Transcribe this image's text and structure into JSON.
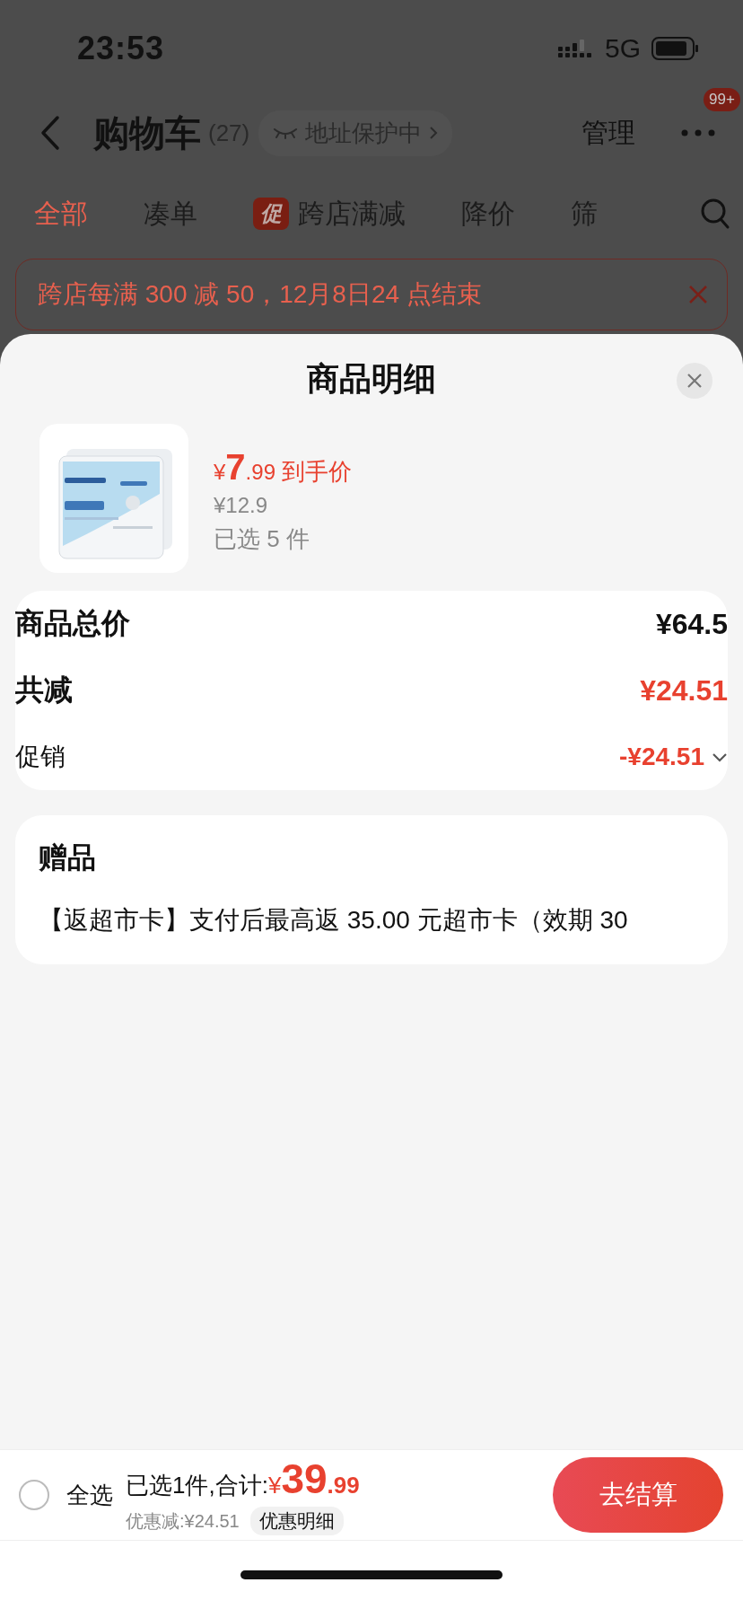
{
  "status_bar": {
    "time": "23:53",
    "network": "5G"
  },
  "header": {
    "title": "购物车",
    "count": "(27)",
    "address_protection": "地址保护中",
    "manage": "管理",
    "more_badge": "99+"
  },
  "tabs": [
    {
      "label": "全部",
      "selected": true
    },
    {
      "label": "凑单",
      "selected": false
    },
    {
      "label": "跨店满减",
      "selected": false,
      "badge": "促"
    },
    {
      "label": "降价",
      "selected": false
    },
    {
      "label": "筛",
      "selected": false
    }
  ],
  "banner": {
    "text": "跨店每满 300 减 50，12月8日24 点结束"
  },
  "sheet": {
    "title": "商品明细",
    "product": {
      "currency": "¥",
      "price_integer": "7",
      "price_decimal": ".99",
      "price_label": "到手价",
      "original_price": "¥12.9",
      "quantity": "已选 5 件"
    },
    "summary": [
      {
        "kind": "total",
        "label": "商品总价",
        "value": "¥64.5"
      },
      {
        "kind": "discount",
        "label": "共减",
        "value": "¥24.51"
      },
      {
        "kind": "detail",
        "label": "促销",
        "value": "-¥24.51",
        "expanded": false
      }
    ],
    "gift": {
      "title": "赠品",
      "text": "【返超市卡】支付后最高返 35.00 元超市卡（效期 30"
    }
  },
  "bottom_bar": {
    "select_all": {
      "label": "全选",
      "checked": false
    },
    "summary": "已选1件,合计:",
    "currency": "¥",
    "total_integer": "39",
    "total_decimal": ".99",
    "discount": "优惠减:¥24.51",
    "details_button": "优惠明细",
    "checkout": "去结算"
  }
}
